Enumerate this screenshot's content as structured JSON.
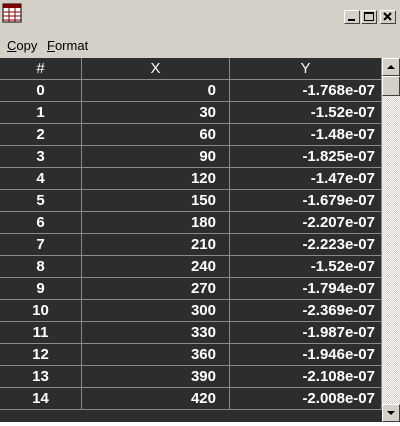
{
  "menu": {
    "copy": "Copy",
    "format": "Format"
  },
  "table": {
    "columns": [
      "#",
      "X",
      "Y"
    ],
    "rows": [
      [
        "0",
        "0",
        "-1.768e-07"
      ],
      [
        "1",
        "30",
        "-1.52e-07"
      ],
      [
        "2",
        "60",
        "-1.48e-07"
      ],
      [
        "3",
        "90",
        "-1.825e-07"
      ],
      [
        "4",
        "120",
        "-1.47e-07"
      ],
      [
        "5",
        "150",
        "-1.679e-07"
      ],
      [
        "6",
        "180",
        "-2.207e-07"
      ],
      [
        "7",
        "210",
        "-2.223e-07"
      ],
      [
        "8",
        "240",
        "-1.52e-07"
      ],
      [
        "9",
        "270",
        "-1.794e-07"
      ],
      [
        "10",
        "300",
        "-2.369e-07"
      ],
      [
        "11",
        "330",
        "-1.987e-07"
      ],
      [
        "12",
        "360",
        "-1.946e-07"
      ],
      [
        "13",
        "390",
        "-2.108e-07"
      ],
      [
        "14",
        "420",
        "-2.008e-07"
      ]
    ]
  },
  "colors": {
    "grid_bg": "#2d2d2d",
    "grid_lines": "#8a8a8a",
    "window_face": "#d4d0c8"
  },
  "icons": {
    "app": "table-grid-icon",
    "minimize": "minimize-icon",
    "maximize": "maximize-icon",
    "close": "close-icon",
    "scroll_up": "arrow-up-icon",
    "scroll_down": "arrow-down-icon"
  }
}
